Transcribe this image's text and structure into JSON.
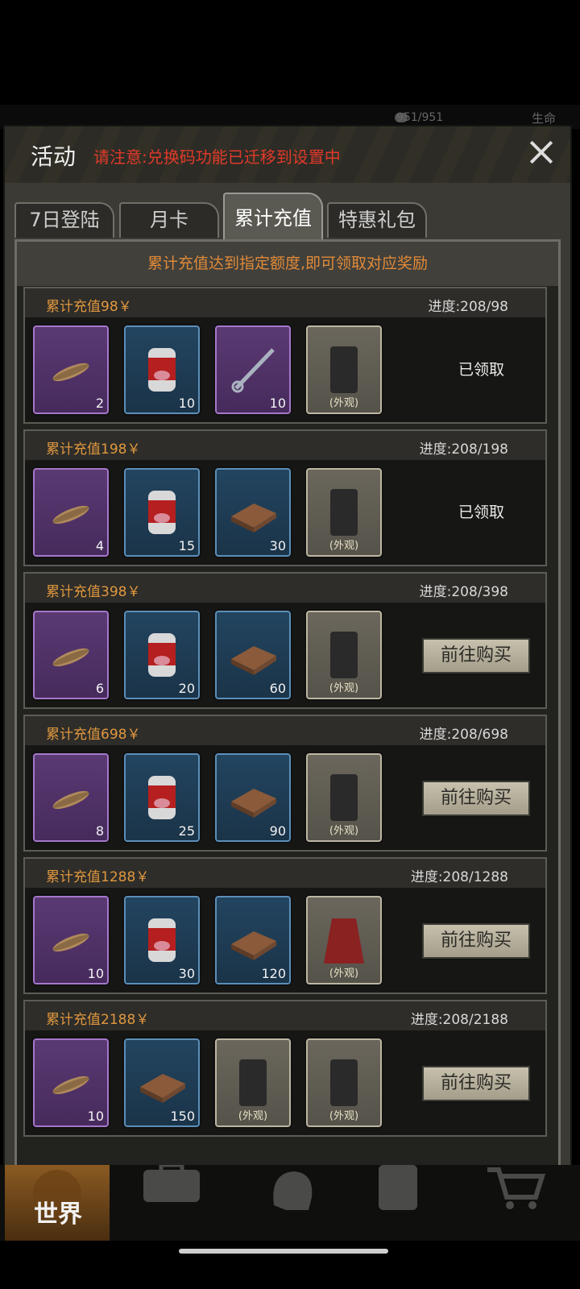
{
  "hud": {
    "hp": "951/951",
    "life_label": "生命"
  },
  "header": {
    "title": "活动",
    "notice": "请注意:兑换码功能已迁移到设置中"
  },
  "tabs": [
    {
      "label": "7日登陆",
      "active": false
    },
    {
      "label": "月卡",
      "active": false
    },
    {
      "label": "累计充值",
      "active": true
    },
    {
      "label": "特惠礼包",
      "active": false
    }
  ],
  "intro": "累计充值达到指定额度,即可领取对应奖励",
  "look_label": "(外观)",
  "tiers": [
    {
      "title": "累计充值98￥",
      "progress": "进度:208/98",
      "counts": [
        "2",
        "10",
        "10"
      ],
      "status": "已领取"
    },
    {
      "title": "累计充值198￥",
      "progress": "进度:208/198",
      "counts": [
        "4",
        "15",
        "30"
      ],
      "status": "已领取"
    },
    {
      "title": "累计充值398￥",
      "progress": "进度:208/398",
      "counts": [
        "6",
        "20",
        "60"
      ],
      "status": "前往购买"
    },
    {
      "title": "累计充值698￥",
      "progress": "进度:208/698",
      "counts": [
        "8",
        "25",
        "90"
      ],
      "status": "前往购买"
    },
    {
      "title": "累计充值1288￥",
      "progress": "进度:208/1288",
      "counts": [
        "10",
        "30",
        "120"
      ],
      "status": "前往购买"
    },
    {
      "title": "累计充值2188￥",
      "progress": "进度:208/2188",
      "counts": [
        "10",
        "150"
      ],
      "status": "前往购买"
    }
  ],
  "nav": {
    "world_label": "世界"
  },
  "colors": {
    "notice": "#e03a2a",
    "tier_title": "#e0973f",
    "purple_slot": "#5b3a73",
    "blue_slot": "#234560"
  }
}
